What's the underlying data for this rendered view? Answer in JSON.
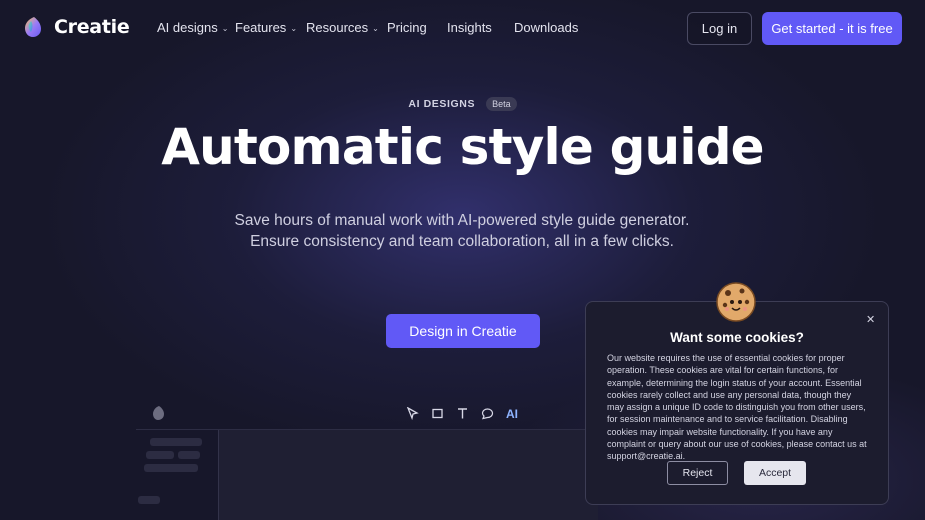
{
  "brand": {
    "name": "Creatie"
  },
  "nav": {
    "items": [
      {
        "label": "AI designs",
        "has_dropdown": true
      },
      {
        "label": "Features",
        "has_dropdown": true
      },
      {
        "label": "Resources",
        "has_dropdown": true
      },
      {
        "label": "Pricing",
        "has_dropdown": false
      },
      {
        "label": "Insights",
        "has_dropdown": false
      },
      {
        "label": "Downloads",
        "has_dropdown": false
      }
    ],
    "login_label": "Log in",
    "cta_label": "Get started - it is free"
  },
  "hero": {
    "eyebrow": "AI DESIGNS",
    "badge": "Beta",
    "title": "Automatic style guide",
    "subtitle": "Save hours of manual work with AI-powered style guide generator. Ensure consistency and team collaboration, all in a few clicks.",
    "cta_label": "Design in Creatie"
  },
  "editor_preview": {
    "toolbar": [
      "pointer-icon",
      "frame-icon",
      "text-icon",
      "comment-icon",
      "ai-icon"
    ],
    "ai_label": "AI"
  },
  "cookie_dialog": {
    "title": "Want some cookies?",
    "body": "Our website requires the use of essential cookies for proper operation. These cookies are vital for certain functions, for example, determining the login status of your account. Essential cookies rarely collect and use any personal data, though they may assign a unique ID code to distinguish you from other users, for session maintenance and to service facilitation. Disabling cookies may impair website functionality. If you have any complaint or query about our use of cookies, please contact us at support@creatie.ai.",
    "reject_label": "Reject",
    "accept_label": "Accept",
    "close_icon": "close-icon"
  },
  "colors": {
    "background": "#17172a",
    "accent": "#6159f6",
    "modal_bg": "#1c1c2e"
  }
}
